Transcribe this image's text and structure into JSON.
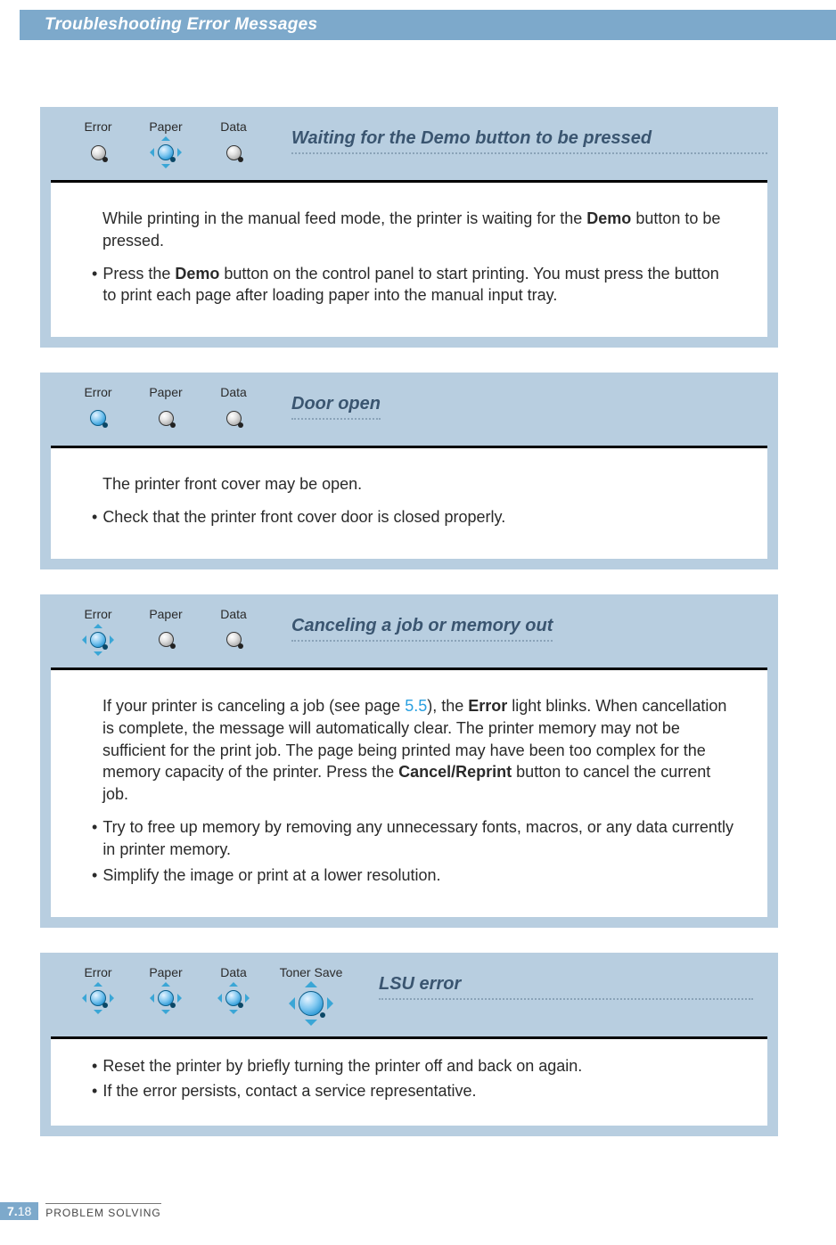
{
  "header": {
    "title": "Troubleshooting Error Messages"
  },
  "leds": {
    "error": "Error",
    "paper": "Paper",
    "data": "Data",
    "toner_save": "Toner Save"
  },
  "sections": [
    {
      "title": "Waiting for the Demo button to be pressed",
      "intro_pre": "While printing in the manual feed mode, the printer is waiting for the ",
      "intro_bold": "Demo",
      "intro_post": " button to be pressed.",
      "bullet1_pre": "Press the ",
      "bullet1_bold": "Demo",
      "bullet1_post": " button on the control panel to start printing. You must press the button to print each page after loading paper into the manual input tray."
    },
    {
      "title": "Door open",
      "intro": "The printer front cover may be open.",
      "bullet1": "Check that the printer front cover door is closed properly."
    },
    {
      "title": "Canceling a job or memory out",
      "intro_pre": "If your printer is canceling a job (see page ",
      "intro_link": "5.5",
      "intro_mid1": "), the ",
      "intro_bold1": "Error",
      "intro_mid2": " light blinks. When cancellation is complete, the message will automatically clear. The printer memory may not be sufficient for the print job. The page being printed may have been too complex for the memory capacity of the printer. Press the ",
      "intro_bold2": "Cancel/Reprint",
      "intro_post": " button to cancel the current job.",
      "bullet1": "Try to free up memory by removing any unnecessary fonts, macros, or any data currently in printer memory.",
      "bullet2": "Simplify the image or print at a lower resolution."
    },
    {
      "title": "LSU error",
      "bullet1": "Reset the printer by briefly turning the printer off and back on again.",
      "bullet2": "If the error persists, contact a service representative."
    }
  ],
  "footer": {
    "page_chapter": "7.",
    "page_num": "18",
    "label": "PROBLEM SOLVING"
  }
}
